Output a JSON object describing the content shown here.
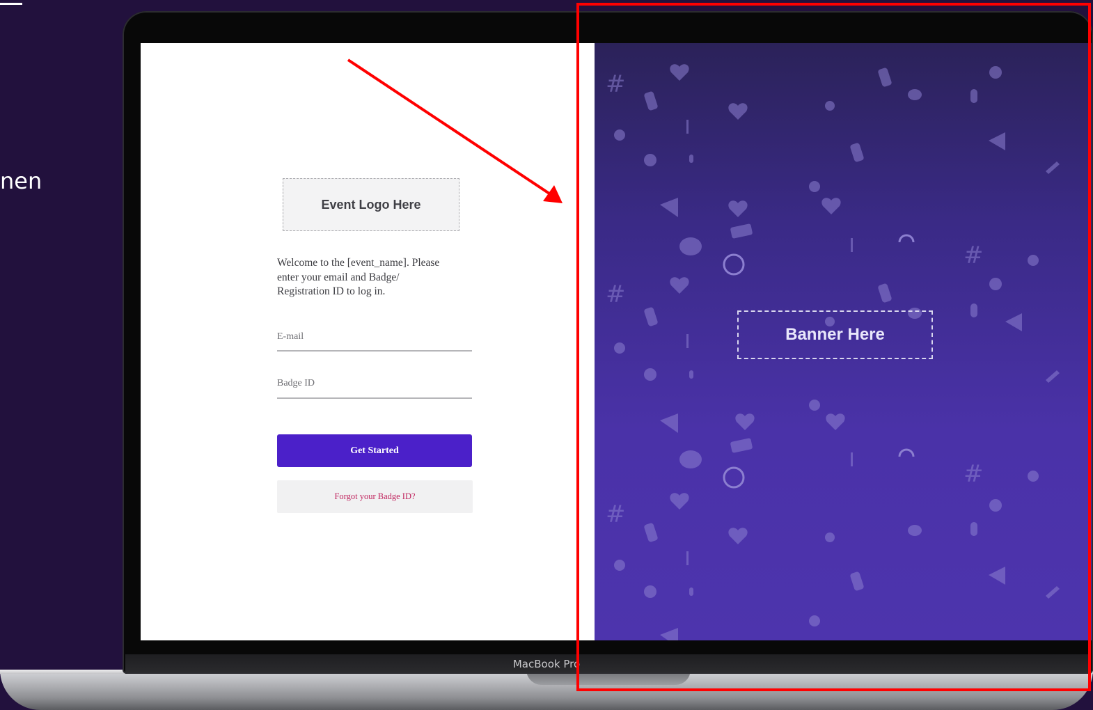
{
  "side_caption": "nen",
  "device": {
    "label": "MacBook Pro"
  },
  "login": {
    "logo_placeholder": "Event Logo Here",
    "welcome_lines": [
      "Welcome to the [event_name]. Please",
      "enter your email and Badge/",
      "Registration ID to log in."
    ],
    "email_label": "E-mail",
    "badge_label": "Badge ID",
    "primary_button": "Get Started",
    "secondary_button": "Forgot your Badge ID?"
  },
  "banner": {
    "placeholder": "Banner Here"
  },
  "colors": {
    "page_background": "#22113d",
    "primary_button": "#4b20c9",
    "link_text": "#c0245e",
    "annotation": "#ff0000",
    "banner_gradient_top": "#2b2259",
    "banner_gradient_bottom": "#4d34ad"
  },
  "icons": [
    "hashtag-icon",
    "heart-icon",
    "rock-hand-icon",
    "music-note-icon",
    "microphone-icon",
    "megaphone-icon",
    "speech-bubble-icon",
    "play-icon",
    "guitar-icon",
    "live-tag-icon",
    "headphones-icon",
    "people-icon"
  ]
}
